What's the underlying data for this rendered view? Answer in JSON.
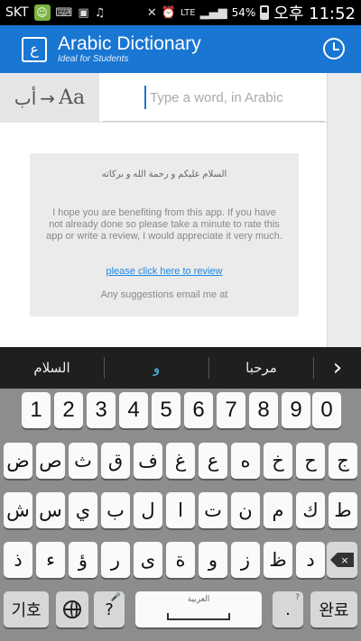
{
  "status": {
    "carrier": "SKT",
    "network": "LTE",
    "battery": "54%",
    "time": "오후 11:52"
  },
  "app": {
    "title": "Arabic Dictionary",
    "subtitle": "Ideal for Students",
    "logo_glyph": "ع"
  },
  "search": {
    "translit_from": "أب",
    "translit_arrow": "→",
    "translit_to": "Aa",
    "placeholder": "Type a word, in Arabic"
  },
  "card": {
    "greeting": "السلام عليكم و رحمة الله و بركاته",
    "message": "I hope you are benefiting from this app. If you have not already done so please take a minute to rate this app or write a review, I would appreciate it very much.",
    "review_link": "please click here to review",
    "suggestions": "Any suggestions email me at"
  },
  "suggestion_bar": {
    "items": [
      "السلام",
      "و",
      "مرحبا"
    ],
    "next": "›"
  },
  "keyboard": {
    "numbers": [
      "1",
      "2",
      "3",
      "4",
      "5",
      "6",
      "7",
      "8",
      "9",
      "0"
    ],
    "row1": [
      "ض",
      "ص",
      "ث",
      "ق",
      "ف",
      "غ",
      "ع",
      "ه",
      "خ",
      "ح",
      "ج"
    ],
    "row2": [
      "ش",
      "س",
      "ي",
      "ب",
      "ل",
      "ا",
      "ت",
      "ن",
      "م",
      "ك",
      "ط"
    ],
    "row3": [
      "ذ",
      "ء",
      "ؤ",
      "ر",
      "ى",
      "ة",
      "و",
      "ز",
      "ظ",
      "د"
    ],
    "symbols_key": "기호",
    "question_key": "?",
    "question_sub": ";",
    "space_label": "العربية",
    "period_key": ".",
    "period_sub": "?",
    "enter_key": "완료",
    "backspace": "×"
  }
}
